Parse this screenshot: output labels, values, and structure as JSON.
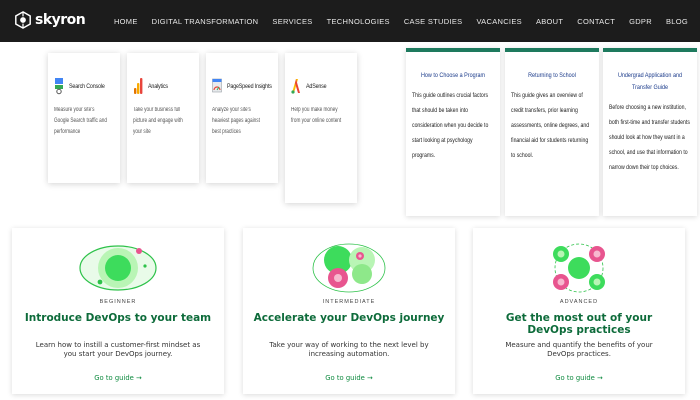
{
  "nav": {
    "logo_text": "skyron",
    "links": [
      "HOME",
      "DIGITAL TRANSFORMATION",
      "SERVICES",
      "TECHNOLOGIES",
      "CASE STUDIES",
      "VACANCIES",
      "ABOUT",
      "CONTACT",
      "GDPR",
      "BLOG"
    ]
  },
  "tools": [
    {
      "name": "Search Console",
      "icon": "search-console-icon",
      "description": "Measure your site's Google Search traffic and performance"
    },
    {
      "name": "Analytics",
      "icon": "analytics-icon",
      "description": "Take your business full picture and engage with your site"
    },
    {
      "name": "PageSpeed Insights",
      "icon": "pagespeed-icon",
      "description": "Analyze your site's heaviest pages against best practices"
    },
    {
      "name": "AdSense",
      "icon": "adsense-icon",
      "description": "Help you make money from your online content"
    }
  ],
  "guides": [
    {
      "title": "How to Choose a Program",
      "text": "This guide outlines crucial factors that should be taken into consideration when you decide to start looking at psychology programs."
    },
    {
      "title": "Returning to School",
      "text": "This guide gives an overview of credit transfers, prior learning assessments, online degrees, and financial aid for students returning to school."
    },
    {
      "title": "Undergrad Application and Transfer Guide",
      "text": "Before choosing a new institution, both first-time and transfer students should look at how they want in a school, and use that information to narrow down their top choices."
    }
  ],
  "devops": [
    {
      "level": "BEGINNER",
      "title": "Introduce DevOps to your team",
      "description": "Learn how to instill a customer-first mindset as you start your DevOps journey.",
      "link": "Go to guide →"
    },
    {
      "level": "INTERMEDIATE",
      "title": "Accelerate your DevOps journey",
      "description": "Take your way of working to the next level by increasing automation.",
      "link": "Go to guide →"
    },
    {
      "level": "ADVANCED",
      "title": "Get the most out of your DevOps practices",
      "description": "Measure and quantify the benefits of your DevOps practices.",
      "link": "Go to guide →"
    }
  ],
  "colors": {
    "nav_bg": "#1c1c1c",
    "guide_accent": "#1e7a5e",
    "devops_green": "#0d6b3a",
    "illus_green": "#3ddc5c",
    "illus_pink": "#e8558f"
  }
}
